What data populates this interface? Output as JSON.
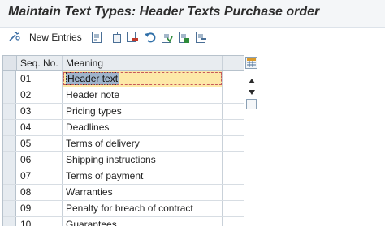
{
  "window": {
    "title": "Maintain Text Types: Header Texts Purchase order"
  },
  "toolbar": {
    "new_entries_label": "New Entries",
    "icons": [
      "glasses-change-icon",
      "details-icon",
      "copy-as-icon",
      "delete-icon",
      "undo-change-icon",
      "select-all-icon",
      "select-block-icon",
      "deselect-all-icon"
    ]
  },
  "table": {
    "columns": [
      "Seq. No.",
      "Meaning"
    ],
    "rows": [
      {
        "seq": "01",
        "meaning": "Header text",
        "selected": true
      },
      {
        "seq": "02",
        "meaning": "Header note"
      },
      {
        "seq": "03",
        "meaning": "Pricing types"
      },
      {
        "seq": "04",
        "meaning": "Deadlines"
      },
      {
        "seq": "05",
        "meaning": "Terms of delivery"
      },
      {
        "seq": "06",
        "meaning": "Shipping instructions"
      },
      {
        "seq": "07",
        "meaning": "Terms of payment"
      },
      {
        "seq": "08",
        "meaning": "Warranties"
      },
      {
        "seq": "09",
        "meaning": "Penalty for breach of contract"
      },
      {
        "seq": "10",
        "meaning": "Guarantees"
      }
    ]
  },
  "colors": {
    "accent": "#2f6fa8",
    "selected_cell": "#fde9a8",
    "header_bg": "#e8ecf0"
  }
}
